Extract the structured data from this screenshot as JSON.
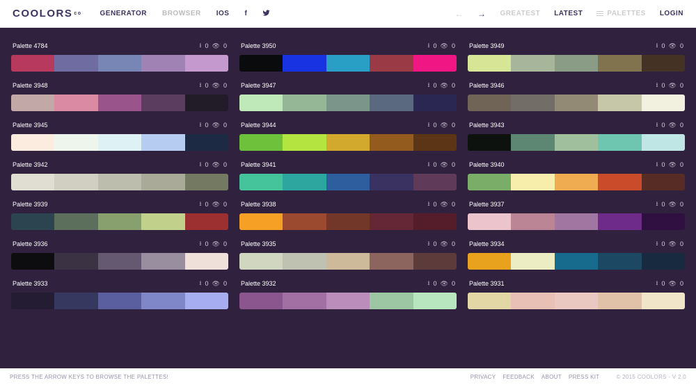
{
  "logo": "COOLORS",
  "nav": {
    "generator": "GENERATOR",
    "browser": "BROWSER",
    "ios": "IOS"
  },
  "topright": {
    "greatest": "GREATEST",
    "latest": "LATEST",
    "palettes": "PALETTES",
    "login": "LOGIN"
  },
  "footer": {
    "hint": "PRESS THE ARROW KEYS TO BROWSE THE PALETTES!",
    "privacy": "PRIVACY",
    "feedback": "FEEDBACK",
    "about": "ABOUT",
    "presskit": "PRESS KIT",
    "copy": "© 2015 COOLORS - V 2.0"
  },
  "palettes": [
    {
      "name": "Palette 4784",
      "downloads": "0",
      "views": "0",
      "colors": [
        "#b73a5e",
        "#6f6ca1",
        "#7786b4",
        "#a083b4",
        "#c49ace"
      ]
    },
    {
      "name": "Palette 3950",
      "downloads": "0",
      "views": "0",
      "colors": [
        "#0a0b0c",
        "#1733e2",
        "#2a9fc5",
        "#9a3a44",
        "#f01784"
      ]
    },
    {
      "name": "Palette 3949",
      "downloads": "0",
      "views": "0",
      "colors": [
        "#d7e597",
        "#a7b59a",
        "#8a9b86",
        "#82734f",
        "#443324"
      ]
    },
    {
      "name": "Palette 3948",
      "downloads": "0",
      "views": "0",
      "colors": [
        "#c2a9a8",
        "#da8aa3",
        "#98548b",
        "#5b3d60",
        "#221b28"
      ]
    },
    {
      "name": "Palette 3947",
      "downloads": "0",
      "views": "0",
      "colors": [
        "#c0e9ba",
        "#95b796",
        "#7c958b",
        "#5b6980",
        "#2a2853"
      ]
    },
    {
      "name": "Palette 3946",
      "downloads": "0",
      "views": "0",
      "colors": [
        "#6f6456",
        "#726e67",
        "#928a74",
        "#c6c7a9",
        "#f2f0de"
      ]
    },
    {
      "name": "Palette 3945",
      "downloads": "0",
      "views": "0",
      "colors": [
        "#fcece0",
        "#eef5ed",
        "#def2f6",
        "#b6cdf1",
        "#1c2a44"
      ]
    },
    {
      "name": "Palette 3944",
      "downloads": "0",
      "views": "0",
      "colors": [
        "#6ec13a",
        "#b4e440",
        "#d3a92d",
        "#935b1e",
        "#5b3515"
      ]
    },
    {
      "name": "Palette 3943",
      "downloads": "0",
      "views": "0",
      "colors": [
        "#0d120f",
        "#5d8772",
        "#a0bf9d",
        "#6ec6b1",
        "#bfe6e4"
      ]
    },
    {
      "name": "Palette 3942",
      "downloads": "0",
      "views": "0",
      "colors": [
        "#e0ded3",
        "#d0cfc2",
        "#bcbdad",
        "#a9aa98",
        "#737a61"
      ]
    },
    {
      "name": "Palette 3941",
      "downloads": "0",
      "views": "0",
      "colors": [
        "#45c39a",
        "#2ea6a0",
        "#2e5e9d",
        "#3a3260",
        "#5f3a59"
      ]
    },
    {
      "name": "Palette 3940",
      "downloads": "0",
      "views": "0",
      "colors": [
        "#7aad68",
        "#f7eeab",
        "#efac50",
        "#c94b29",
        "#572c24"
      ]
    },
    {
      "name": "Palette 3939",
      "downloads": "0",
      "views": "0",
      "colors": [
        "#2c4450",
        "#5c6e5c",
        "#87a06e",
        "#c1d08b",
        "#9c3030"
      ]
    },
    {
      "name": "Palette 3938",
      "downloads": "0",
      "views": "0",
      "colors": [
        "#f6a125",
        "#9c4a2f",
        "#723728",
        "#652735",
        "#551d2a"
      ]
    },
    {
      "name": "Palette 3937",
      "downloads": "0",
      "views": "0",
      "colors": [
        "#ecc4cc",
        "#bb8596",
        "#a176a0",
        "#6f2b8a",
        "#2f1040"
      ]
    },
    {
      "name": "Palette 3936",
      "downloads": "0",
      "views": "0",
      "colors": [
        "#0d0d0f",
        "#3b3344",
        "#655971",
        "#998ea0",
        "#efe1d9"
      ]
    },
    {
      "name": "Palette 3935",
      "downloads": "0",
      "views": "0",
      "colors": [
        "#d1d6c1",
        "#bfc2b0",
        "#ccba9a",
        "#8c655f",
        "#5c3b3a"
      ]
    },
    {
      "name": "Palette 3934",
      "downloads": "0",
      "views": "0",
      "colors": [
        "#e9a21e",
        "#ecedc2",
        "#176b8d",
        "#1c4864",
        "#172a40"
      ]
    },
    {
      "name": "Palette 3933",
      "downloads": "0",
      "views": "0",
      "colors": [
        "#231c32",
        "#363860",
        "#5a5f9f",
        "#8087c8",
        "#a6adf0"
      ]
    },
    {
      "name": "Palette 3932",
      "downloads": "0",
      "views": "0",
      "colors": [
        "#8a568d",
        "#a370a4",
        "#ba8dbb",
        "#9dc6a3",
        "#b7e6bf"
      ]
    },
    {
      "name": "Palette 3931",
      "downloads": "0",
      "views": "0",
      "colors": [
        "#e3d8a5",
        "#e8c0b6",
        "#e8c8c0",
        "#e0c2a8",
        "#f0e5c8"
      ]
    }
  ]
}
